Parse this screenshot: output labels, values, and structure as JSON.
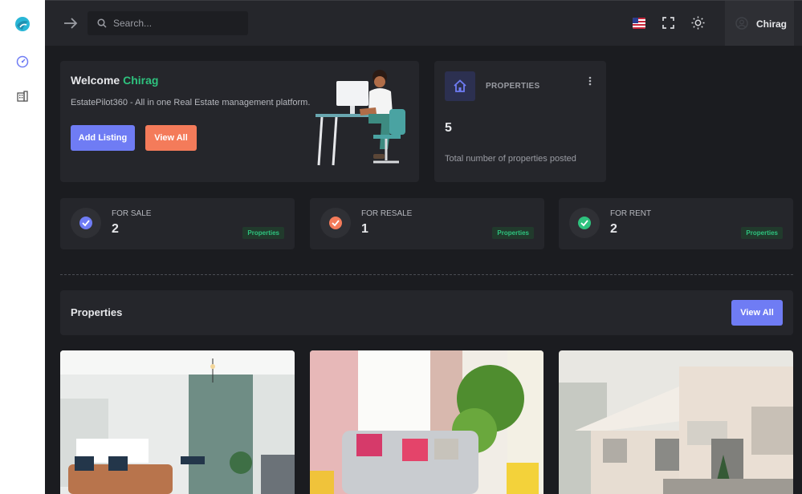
{
  "sidebar": {
    "icons": [
      "app-logo-icon",
      "dashboard-gauge-icon",
      "building-icon"
    ]
  },
  "header": {
    "search_placeholder": "Search...",
    "language_flag": "us-flag-icon",
    "user_name": "Chirag"
  },
  "welcome": {
    "title_prefix": "Welcome",
    "user_name": "Chirag",
    "description": "EstatePilot360 - All in one Real Estate management platform.",
    "add_listing_label": "Add Listing",
    "view_all_label": "View All"
  },
  "properties_card": {
    "label": "PROPERTIES",
    "count": "5",
    "subtitle": "Total number of properties posted"
  },
  "stats": [
    {
      "label": "FOR SALE",
      "value": "2",
      "badge": "Properties",
      "color": "#6f7cf4"
    },
    {
      "label": "FOR RESALE",
      "value": "1",
      "badge": "Properties",
      "color": "#f47b5a"
    },
    {
      "label": "FOR RENT",
      "value": "2",
      "badge": "Properties",
      "color": "#2ec27e"
    }
  ],
  "properties_section": {
    "title": "Properties",
    "view_all_label": "View All"
  },
  "listings": [
    {
      "image": "living-room-photo"
    },
    {
      "image": "sofa-room-photo"
    },
    {
      "image": "house-exterior-photo"
    }
  ],
  "colors": {
    "primary": "#6f7cf4",
    "accent": "#f47b5a",
    "success": "#2ec27e",
    "background": "#1b1c20",
    "card": "#25262b"
  }
}
